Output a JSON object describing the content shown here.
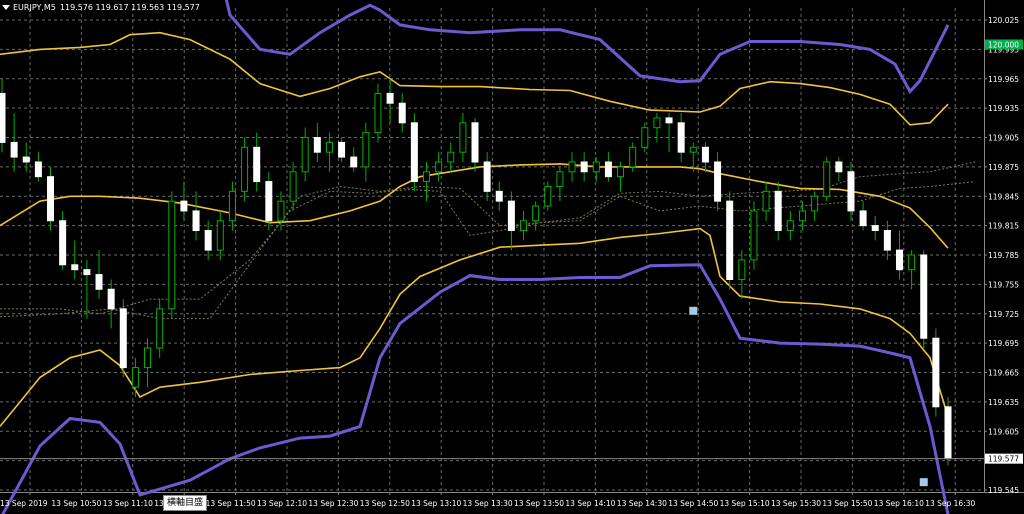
{
  "window": {
    "symbol": "EURJPY,M5",
    "ohlc": "119.576 119.617 119.563 119.577",
    "tooltip": "横軸目盛"
  },
  "colors": {
    "background": "#000000",
    "grid": "#6a6a6a",
    "bull_candle_body": "#000000",
    "bull_candle_outline": "#00b000",
    "bear_candle_body": "#ffffff",
    "wick": "#00b000",
    "band_yellow": "#f0c43a",
    "band_purple": "#6b5bd0",
    "cloud_line": "#807850",
    "bid_line": "#8a8a8a",
    "current_price_tag": "#00b050",
    "last_price_tag": "#ffffff"
  },
  "chart_data": {
    "type": "candlestick",
    "title": "EURJPY,M5",
    "ylim": [
      119.53,
      120.03
    ],
    "y_ticks": [
      "120.025",
      "119.995",
      "119.965",
      "119.935",
      "119.905",
      "119.875",
      "119.845",
      "119.815",
      "119.785",
      "119.755",
      "119.725",
      "119.695",
      "119.665",
      "119.635",
      "119.605",
      "119.575",
      "119.545"
    ],
    "y_tick_values": [
      120.025,
      119.995,
      119.965,
      119.935,
      119.905,
      119.875,
      119.845,
      119.815,
      119.785,
      119.755,
      119.725,
      119.695,
      119.665,
      119.635,
      119.605,
      119.575,
      119.545
    ],
    "current_price_tag": "120.000",
    "current_price": 120.0,
    "last_price_tag": "119.577",
    "last_price": 119.577,
    "x_ticks": [
      "13 Sep 2019",
      "13 Sep 10:50",
      "13 Sep 11:10",
      "13 Sep 11:30",
      "13 Sep 11:50",
      "13 Sep 12:10",
      "13 Sep 12:30",
      "13 Sep 12:50",
      "13 Sep 13:10",
      "13 Sep 13:30",
      "13 Sep 13:50",
      "13 Sep 14:10",
      "13 Sep 14:30",
      "13 Sep 14:50",
      "13 Sep 15:10",
      "13 Sep 15:30",
      "13 Sep 15:50",
      "13 Sep 16:10",
      "13 Sep 16:30"
    ],
    "candles": [
      [
        119.95,
        119.965,
        119.89,
        119.9
      ],
      [
        119.9,
        119.93,
        119.87,
        119.885
      ],
      [
        119.885,
        119.9,
        119.87,
        119.88
      ],
      [
        119.88,
        119.89,
        119.86,
        119.865
      ],
      [
        119.865,
        119.875,
        119.81,
        119.82
      ],
      [
        119.82,
        119.83,
        119.77,
        119.775
      ],
      [
        119.775,
        119.8,
        119.76,
        119.77
      ],
      [
        119.77,
        119.78,
        119.72,
        119.765
      ],
      [
        119.765,
        119.79,
        119.74,
        119.75
      ],
      [
        119.75,
        119.76,
        119.71,
        119.73
      ],
      [
        119.73,
        119.74,
        119.66,
        119.67
      ],
      [
        119.65,
        119.68,
        119.64,
        119.67
      ],
      [
        119.67,
        119.7,
        119.65,
        119.69
      ],
      [
        119.69,
        119.74,
        119.68,
        119.73
      ],
      [
        119.73,
        119.85,
        119.72,
        119.84
      ],
      [
        119.84,
        119.86,
        119.82,
        119.83
      ],
      [
        119.83,
        119.85,
        119.8,
        119.81
      ],
      [
        119.81,
        119.82,
        119.78,
        119.79
      ],
      [
        119.79,
        119.83,
        119.78,
        119.82
      ],
      [
        119.82,
        119.86,
        119.81,
        119.85
      ],
      [
        119.85,
        119.905,
        119.84,
        119.895
      ],
      [
        119.895,
        119.91,
        119.85,
        119.86
      ],
      [
        119.86,
        119.87,
        119.81,
        119.82
      ],
      [
        119.82,
        119.85,
        119.81,
        119.84
      ],
      [
        119.84,
        119.88,
        119.83,
        119.87
      ],
      [
        119.87,
        119.915,
        119.86,
        119.905
      ],
      [
        119.905,
        119.92,
        119.88,
        119.89
      ],
      [
        119.89,
        119.91,
        119.87,
        119.9
      ],
      [
        119.9,
        119.905,
        119.88,
        119.885
      ],
      [
        119.885,
        119.895,
        119.87,
        119.875
      ],
      [
        119.875,
        119.92,
        119.86,
        119.91
      ],
      [
        119.91,
        119.96,
        119.9,
        119.95
      ],
      [
        119.95,
        119.965,
        119.92,
        119.94
      ],
      [
        119.94,
        119.95,
        119.91,
        119.92
      ],
      [
        119.92,
        119.93,
        119.85,
        119.86
      ],
      [
        119.86,
        119.88,
        119.84,
        119.87
      ],
      [
        119.87,
        119.89,
        119.86,
        119.88
      ],
      [
        119.88,
        119.9,
        119.87,
        119.89
      ],
      [
        119.89,
        119.93,
        119.88,
        119.92
      ],
      [
        119.92,
        119.925,
        119.87,
        119.88
      ],
      [
        119.88,
        119.89,
        119.84,
        119.85
      ],
      [
        119.85,
        119.86,
        119.83,
        119.84
      ],
      [
        119.84,
        119.85,
        119.79,
        119.81
      ],
      [
        119.81,
        119.83,
        119.8,
        119.82
      ],
      [
        119.82,
        119.84,
        119.81,
        119.835
      ],
      [
        119.835,
        119.86,
        119.83,
        119.855
      ],
      [
        119.855,
        119.875,
        119.84,
        119.87
      ],
      [
        119.87,
        119.89,
        119.86,
        119.88
      ],
      [
        119.88,
        119.89,
        119.86,
        119.87
      ],
      [
        119.87,
        119.885,
        119.86,
        119.88
      ],
      [
        119.88,
        119.89,
        119.86,
        119.865
      ],
      [
        119.865,
        119.88,
        119.85,
        119.875
      ],
      [
        119.875,
        119.9,
        119.87,
        119.895
      ],
      [
        119.895,
        119.92,
        119.89,
        119.915
      ],
      [
        119.915,
        119.93,
        119.9,
        119.925
      ],
      [
        119.925,
        119.93,
        119.89,
        119.92
      ],
      [
        119.92,
        119.93,
        119.88,
        119.89
      ],
      [
        119.89,
        119.9,
        119.87,
        119.895
      ],
      [
        119.895,
        119.9,
        119.87,
        119.88
      ],
      [
        119.88,
        119.89,
        119.83,
        119.84
      ],
      [
        119.84,
        119.85,
        119.75,
        119.76
      ],
      [
        119.76,
        119.79,
        119.74,
        119.78
      ],
      [
        119.78,
        119.84,
        119.77,
        119.83
      ],
      [
        119.83,
        119.86,
        119.82,
        119.85
      ],
      [
        119.85,
        119.86,
        119.8,
        119.81
      ],
      [
        119.81,
        119.83,
        119.8,
        119.82
      ],
      [
        119.82,
        119.84,
        119.81,
        119.83
      ],
      [
        119.83,
        119.85,
        119.82,
        119.845
      ],
      [
        119.845,
        119.885,
        119.84,
        119.88
      ],
      [
        119.88,
        119.885,
        119.86,
        119.87
      ],
      [
        119.87,
        119.88,
        119.82,
        119.83
      ],
      [
        119.83,
        119.84,
        119.81,
        119.815
      ],
      [
        119.815,
        119.825,
        119.8,
        119.81
      ],
      [
        119.81,
        119.82,
        119.78,
        119.79
      ],
      [
        119.79,
        119.81,
        119.76,
        119.77
      ],
      [
        119.77,
        119.79,
        119.75,
        119.785
      ],
      [
        119.785,
        119.79,
        119.69,
        119.7
      ],
      [
        119.7,
        119.71,
        119.62,
        119.63
      ],
      [
        119.63,
        119.64,
        119.57,
        119.577
      ]
    ],
    "markers": [
      [
        57,
        119.728
      ],
      [
        76,
        119.553
      ]
    ],
    "bb_mid": [
      [
        0,
        119.815
      ],
      [
        40,
        119.84
      ],
      [
        70,
        119.845
      ],
      [
        100,
        119.845
      ],
      [
        140,
        119.843
      ],
      [
        180,
        119.838
      ],
      [
        230,
        119.828
      ],
      [
        270,
        119.818
      ],
      [
        310,
        119.82
      ],
      [
        350,
        119.83
      ],
      [
        380,
        119.84
      ],
      [
        400,
        119.855
      ],
      [
        420,
        119.865
      ],
      [
        450,
        119.87
      ],
      [
        480,
        119.875
      ],
      [
        520,
        119.877
      ],
      [
        560,
        119.878
      ],
      [
        600,
        119.875
      ],
      [
        640,
        119.875
      ],
      [
        680,
        119.875
      ],
      [
        700,
        119.873
      ],
      [
        720,
        119.868
      ],
      [
        760,
        119.86
      ],
      [
        800,
        119.853
      ],
      [
        840,
        119.852
      ],
      [
        880,
        119.845
      ],
      [
        910,
        119.833
      ],
      [
        930,
        119.813
      ],
      [
        948,
        119.792
      ]
    ],
    "bb_upper1": [
      [
        0,
        119.99
      ],
      [
        40,
        119.995
      ],
      [
        80,
        119.997
      ],
      [
        110,
        120.0
      ],
      [
        130,
        120.01
      ],
      [
        160,
        120.012
      ],
      [
        190,
        120.005
      ],
      [
        230,
        119.985
      ],
      [
        260,
        119.96
      ],
      [
        300,
        119.947
      ],
      [
        330,
        119.955
      ],
      [
        360,
        119.967
      ],
      [
        380,
        119.972
      ],
      [
        400,
        119.958
      ],
      [
        440,
        119.957
      ],
      [
        480,
        119.957
      ],
      [
        530,
        119.954
      ],
      [
        570,
        119.953
      ],
      [
        610,
        119.942
      ],
      [
        650,
        119.933
      ],
      [
        700,
        119.931
      ],
      [
        720,
        119.937
      ],
      [
        740,
        119.955
      ],
      [
        770,
        119.962
      ],
      [
        800,
        119.96
      ],
      [
        830,
        119.956
      ],
      [
        860,
        119.949
      ],
      [
        890,
        119.939
      ],
      [
        910,
        119.918
      ],
      [
        930,
        119.92
      ],
      [
        948,
        119.939
      ]
    ],
    "bb_lower1": [
      [
        0,
        119.61
      ],
      [
        40,
        119.66
      ],
      [
        70,
        119.68
      ],
      [
        100,
        119.688
      ],
      [
        120,
        119.672
      ],
      [
        140,
        119.64
      ],
      [
        160,
        119.65
      ],
      [
        200,
        119.655
      ],
      [
        250,
        119.663
      ],
      [
        300,
        119.667
      ],
      [
        340,
        119.67
      ],
      [
        360,
        119.68
      ],
      [
        380,
        119.71
      ],
      [
        400,
        119.745
      ],
      [
        420,
        119.763
      ],
      [
        460,
        119.78
      ],
      [
        500,
        119.793
      ],
      [
        540,
        119.795
      ],
      [
        580,
        119.797
      ],
      [
        620,
        119.803
      ],
      [
        660,
        119.807
      ],
      [
        700,
        119.812
      ],
      [
        710,
        119.805
      ],
      [
        720,
        119.763
      ],
      [
        740,
        119.743
      ],
      [
        780,
        119.737
      ],
      [
        820,
        119.735
      ],
      [
        860,
        119.73
      ],
      [
        890,
        119.72
      ],
      [
        910,
        119.705
      ],
      [
        930,
        119.68
      ],
      [
        948,
        119.62
      ]
    ],
    "bb_upper2": [
      [
        0,
        120.16
      ],
      [
        60,
        120.17
      ],
      [
        110,
        120.175
      ],
      [
        160,
        120.178
      ],
      [
        200,
        120.16
      ],
      [
        230,
        120.03
      ],
      [
        260,
        119.995
      ],
      [
        290,
        119.99
      ],
      [
        320,
        120.012
      ],
      [
        350,
        120.03
      ],
      [
        370,
        120.04
      ],
      [
        380,
        120.035
      ],
      [
        400,
        120.02
      ],
      [
        430,
        120.015
      ],
      [
        470,
        120.012
      ],
      [
        520,
        120.015
      ],
      [
        560,
        120.015
      ],
      [
        600,
        120.005
      ],
      [
        640,
        119.968
      ],
      [
        680,
        119.962
      ],
      [
        700,
        119.963
      ],
      [
        720,
        119.99
      ],
      [
        750,
        120.003
      ],
      [
        800,
        120.003
      ],
      [
        840,
        120.0
      ],
      [
        870,
        119.995
      ],
      [
        895,
        119.98
      ],
      [
        910,
        119.952
      ],
      [
        920,
        119.963
      ],
      [
        948,
        120.02
      ]
    ],
    "bb_lower2": [
      [
        0,
        119.515
      ],
      [
        40,
        119.59
      ],
      [
        70,
        119.618
      ],
      [
        100,
        119.614
      ],
      [
        120,
        119.592
      ],
      [
        140,
        119.54
      ],
      [
        190,
        119.555
      ],
      [
        230,
        119.577
      ],
      [
        260,
        119.588
      ],
      [
        300,
        119.598
      ],
      [
        330,
        119.6
      ],
      [
        360,
        119.61
      ],
      [
        380,
        119.68
      ],
      [
        400,
        119.715
      ],
      [
        440,
        119.747
      ],
      [
        470,
        119.764
      ],
      [
        500,
        119.76
      ],
      [
        540,
        119.76
      ],
      [
        580,
        119.762
      ],
      [
        620,
        119.762
      ],
      [
        650,
        119.774
      ],
      [
        700,
        119.775
      ],
      [
        720,
        119.74
      ],
      [
        740,
        119.7
      ],
      [
        780,
        119.695
      ],
      [
        820,
        119.694
      ],
      [
        860,
        119.692
      ],
      [
        890,
        119.685
      ],
      [
        910,
        119.68
      ],
      [
        930,
        119.61
      ],
      [
        948,
        119.52
      ]
    ],
    "cloud_a": [
      [
        0,
        119.73
      ],
      [
        60,
        119.73
      ],
      [
        100,
        119.725
      ],
      [
        150,
        119.74
      ],
      [
        200,
        119.74
      ],
      [
        250,
        119.78
      ],
      [
        290,
        119.83
      ],
      [
        330,
        119.85
      ],
      [
        370,
        119.848
      ],
      [
        410,
        119.852
      ],
      [
        440,
        119.85
      ],
      [
        470,
        119.805
      ],
      [
        500,
        119.81
      ],
      [
        540,
        119.818
      ],
      [
        580,
        119.82
      ],
      [
        620,
        119.845
      ],
      [
        660,
        119.83
      ],
      [
        700,
        119.835
      ],
      [
        740,
        119.83
      ],
      [
        800,
        119.835
      ],
      [
        860,
        119.84
      ],
      [
        900,
        119.853
      ],
      [
        930,
        119.855
      ],
      [
        975,
        119.86
      ]
    ],
    "cloud_b": [
      [
        0,
        119.722
      ],
      [
        60,
        119.725
      ],
      [
        110,
        119.73
      ],
      [
        160,
        119.72
      ],
      [
        210,
        119.72
      ],
      [
        260,
        119.79
      ],
      [
        300,
        119.845
      ],
      [
        340,
        119.855
      ],
      [
        380,
        119.85
      ],
      [
        420,
        119.855
      ],
      [
        460,
        119.853
      ],
      [
        500,
        119.815
      ],
      [
        540,
        119.818
      ],
      [
        580,
        119.823
      ],
      [
        620,
        119.848
      ],
      [
        660,
        119.85
      ],
      [
        700,
        119.845
      ],
      [
        740,
        119.848
      ],
      [
        780,
        119.85
      ],
      [
        820,
        119.852
      ],
      [
        860,
        119.865
      ],
      [
        900,
        119.868
      ],
      [
        930,
        119.87
      ],
      [
        975,
        119.88
      ]
    ]
  }
}
